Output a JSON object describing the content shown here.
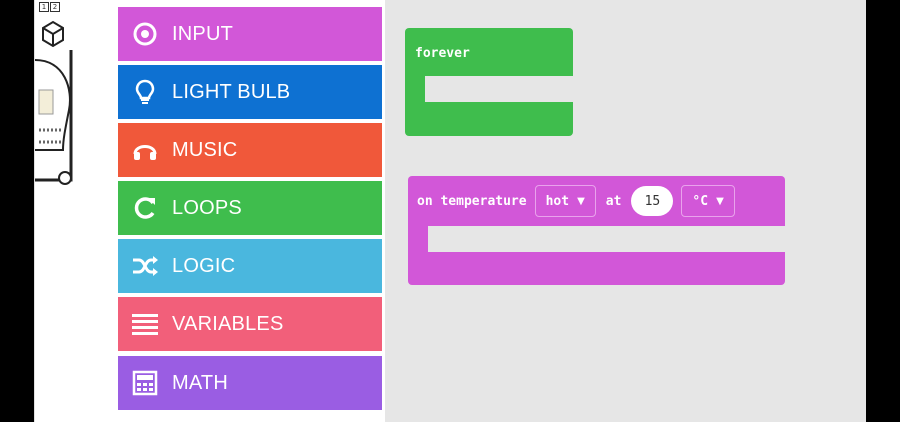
{
  "simulator": {
    "tabs": [
      "1",
      "2"
    ]
  },
  "toolbox": {
    "categories": [
      {
        "label": "INPUT",
        "icon": "input-circle-icon",
        "color": "#d257d8"
      },
      {
        "label": "LIGHT BULB",
        "icon": "light-bulb-icon",
        "color": "#0e71d2"
      },
      {
        "label": "MUSIC",
        "icon": "headphones-icon",
        "color": "#f0583a"
      },
      {
        "label": "LOOPS",
        "icon": "refresh-loop-icon",
        "color": "#3fbd4d"
      },
      {
        "label": "LOGIC",
        "icon": "shuffle-icon",
        "color": "#4ab7de"
      },
      {
        "label": "VARIABLES",
        "icon": "list-lines-icon",
        "color": "#f25f7a"
      },
      {
        "label": "MATH",
        "icon": "calculator-icon",
        "color": "#9a5de3"
      }
    ]
  },
  "workspace": {
    "forever_block": {
      "label": "forever",
      "color": "#3fbd4d"
    },
    "temperature_block": {
      "label": "on temperature",
      "condition": "hot",
      "at_label": "at",
      "value": "15",
      "unit": "°C",
      "color": "#d257d8"
    }
  }
}
